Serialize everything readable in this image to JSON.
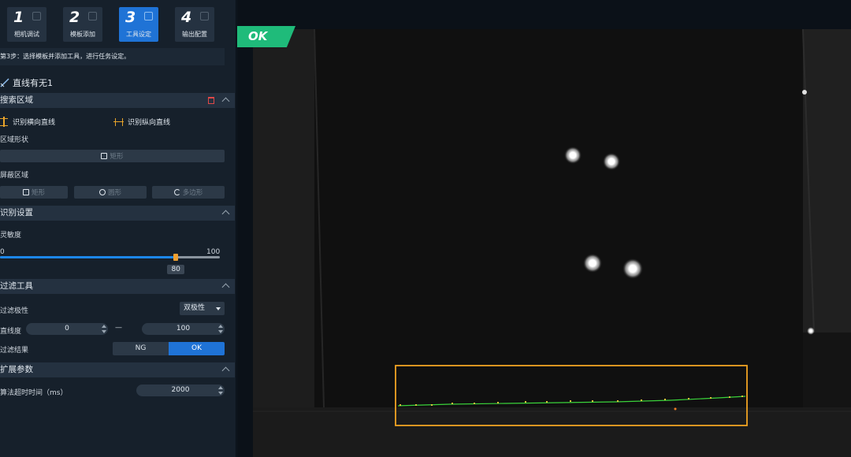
{
  "steps": [
    {
      "num": "1",
      "label": "相机调试",
      "active": false
    },
    {
      "num": "2",
      "label": "模板添加",
      "active": false
    },
    {
      "num": "3",
      "label": "工具设定",
      "active": true
    },
    {
      "num": "4",
      "label": "输出配置",
      "active": false
    }
  ],
  "hint": "第3步：选择模板并添加工具，进行任务设定。",
  "tool_name": "直线有无1",
  "search_area": {
    "title": "搜索区域",
    "horizontal_line": "识别横向直线",
    "vertical_line": "识别纵向直线",
    "shape_label": "区域形状",
    "shape_button": "矩形",
    "mask_label": "屏蔽区域",
    "mask_buttons": [
      "矩形",
      "圆形",
      "多边形"
    ]
  },
  "recognition": {
    "title": "识别设置",
    "sensitivity_label": "灵敏度",
    "min": "0",
    "max": "100",
    "value": 80
  },
  "filter": {
    "title": "过滤工具",
    "polarity_label": "过滤极性",
    "polarity_value": "双极性",
    "straightness_label": "直线度",
    "straightness_min": "0",
    "dash": "—",
    "straightness_max": "100",
    "result_label": "过滤结果",
    "result_ng": "NG",
    "result_ok": "OK"
  },
  "extended": {
    "title": "扩展参数",
    "timeout_label": "算法超时时间（ms）",
    "timeout_value": "2000"
  },
  "viewer": {
    "status": "OK",
    "status_color": "#1fbb7a",
    "roi_color": "#f0a322",
    "edge_color": "#3ad23a"
  }
}
